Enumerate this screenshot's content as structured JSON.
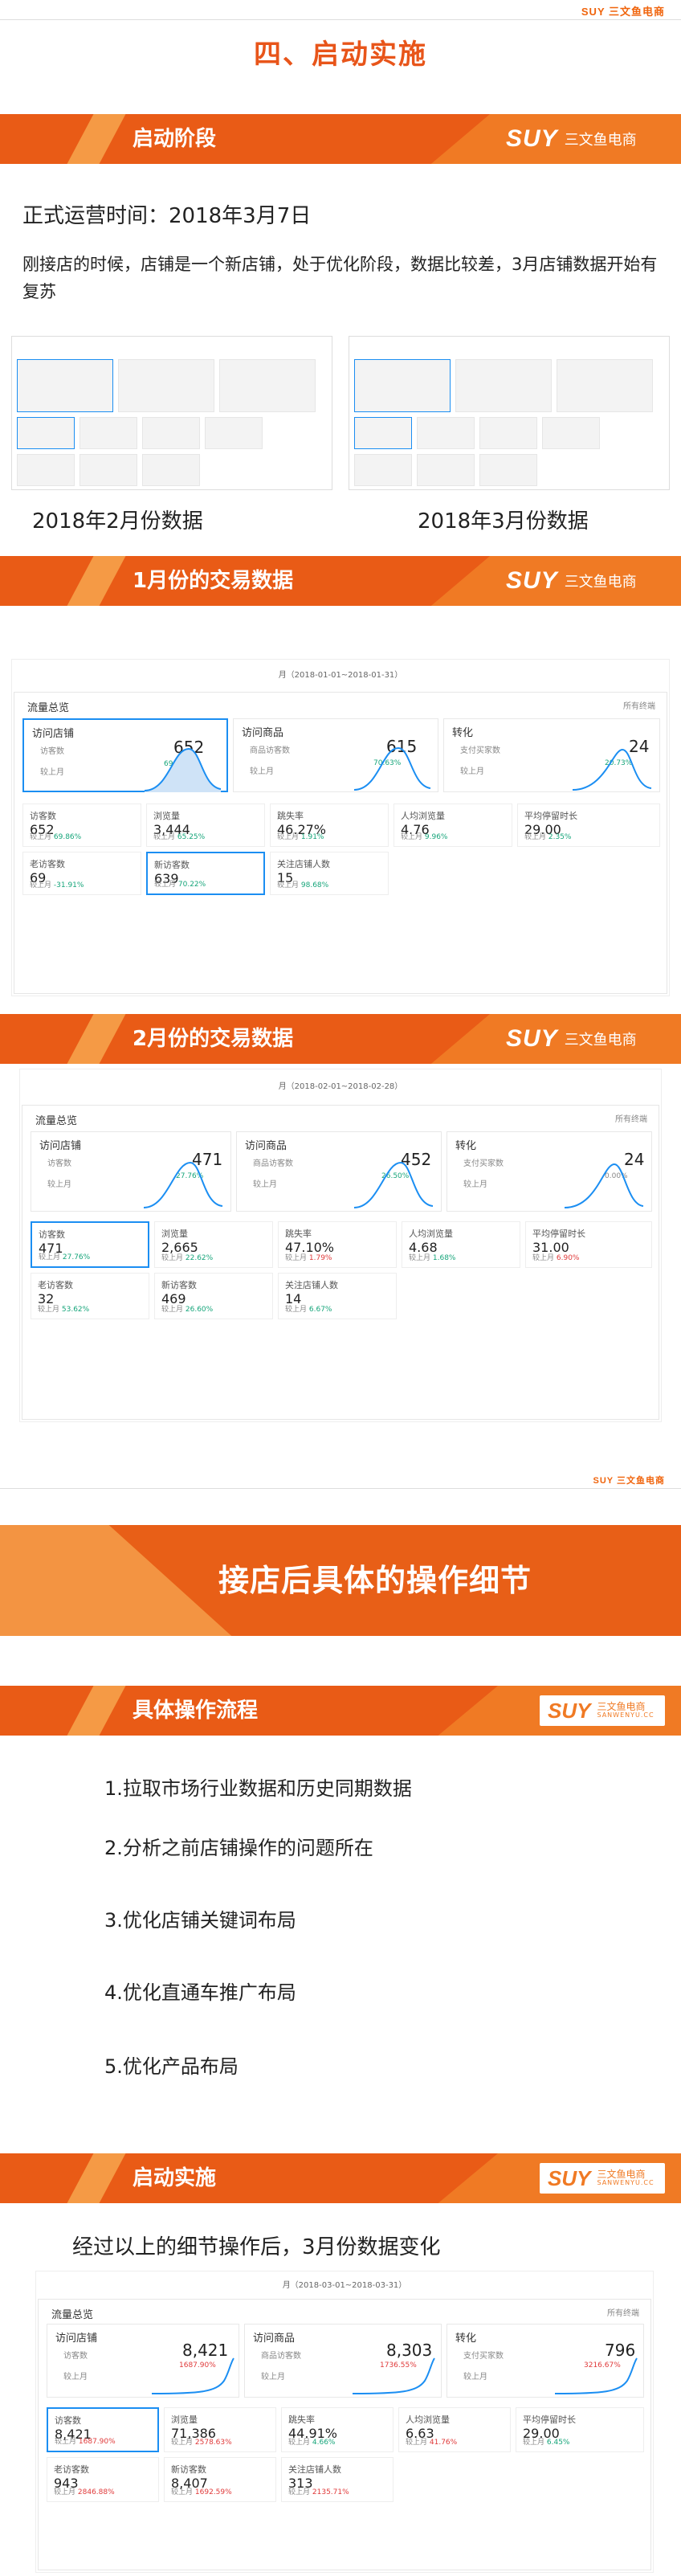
{
  "top_logo": "SUY 三文鱼电商",
  "section_title": "四、启动实施",
  "banners": {
    "launch_stage": "启动阶段",
    "jan_data": "1月份的交易数据",
    "feb_data": "2月份的交易数据",
    "procedure": "具体操作流程",
    "implementation": "启动实施",
    "brand_suy": "SUY",
    "brand_cn": "三文鱼电商",
    "brand_en": "SANWENYU.CC"
  },
  "intro": {
    "launch_time": "正式运营时间：2018年3月7日",
    "description": "刚接店的时候，店铺是一个新店铺，处于优化阶段，数据比较差，3月店铺数据开始有复苏",
    "caption_feb": "2018年2月份数据",
    "caption_mar": "2018年3月份数据"
  },
  "common": {
    "panel_title": "流量总览",
    "panel_right": "所有终端",
    "card1_title": "访问店铺",
    "card1_sub": "访客数",
    "card2_title": "访问商品",
    "card2_sub": "商品访客数",
    "card3_title": "转化",
    "card3_sub": "支付买家数",
    "compare": "较上月",
    "m_visitors": "访客数",
    "m_pv": "浏览量",
    "m_bounce": "跳失率",
    "m_pv_per": "人均浏览量",
    "m_stay": "平均停留时长",
    "m_old": "老访客数",
    "m_new": "新访客数",
    "m_fans": "关注店铺人数"
  },
  "jan": {
    "date_range": "月（2018-01-01~2018-01-31）",
    "card1_value": "652",
    "card1_change": "69.46%",
    "card2_value": "615",
    "card2_change": "70.63%",
    "card3_value": "24",
    "card3_change": "20.73%",
    "visitors": "652",
    "visitors_change": "69.86%",
    "pv": "3,444",
    "pv_change": "65.25%",
    "bounce": "46.27%",
    "bounce_change": "1.91%",
    "pv_per": "4.76",
    "pv_per_change": "9.96%",
    "stay": "29.00",
    "stay_change": "2.35%",
    "old": "69",
    "old_change": "-31.91%",
    "new": "639",
    "new_change": "70.22%",
    "fans": "15",
    "fans_change": "98.68%"
  },
  "feb": {
    "date_range": "月（2018-02-01~2018-02-28）",
    "card1_value": "471",
    "card1_change": "27.76%",
    "card2_value": "452",
    "card2_change": "26.50%",
    "card3_value": "24",
    "card3_change": "0.00%",
    "visitors": "471",
    "visitors_change": "27.76%",
    "pv": "2,665",
    "pv_change": "22.62%",
    "bounce": "47.10%",
    "bounce_change": "1.79%",
    "pv_per": "4.68",
    "pv_per_change": "1.68%",
    "stay": "31.00",
    "stay_change": "6.90%",
    "old": "32",
    "old_change": "53.62%",
    "new": "469",
    "new_change": "26.60%",
    "fans": "14",
    "fans_change": "6.67%"
  },
  "mar": {
    "date_range": "月（2018-03-01~2018-03-31）",
    "card1_value": "8,421",
    "card1_change": "1687.90%",
    "card2_value": "8,303",
    "card2_change": "1736.55%",
    "card3_value": "796",
    "card3_change": "3216.67%",
    "visitors": "8,421",
    "visitors_change": "1687.90%",
    "pv": "71,386",
    "pv_change": "2578.63%",
    "bounce": "44.91%",
    "bounce_change": "4.66%",
    "pv_per": "6.63",
    "pv_per_change": "41.76%",
    "stay": "29.00",
    "stay_change": "6.45%",
    "old": "943",
    "old_change": "2846.88%",
    "new": "8,407",
    "new_change": "1692.59%",
    "fans": "313",
    "fans_change": "2135.71%"
  },
  "details_banner": "接店后具体的操作细节",
  "steps": [
    "1.拉取市场行业数据和历史同期数据",
    "2.分析之前店铺操作的问题所在",
    "3.优化店铺关键词布局",
    "4.优化直通车推广布局",
    "5.优化产品布局"
  ],
  "result_text": "经过以上的细节操作后，3月份数据变化",
  "colors": {
    "orange": "#f07a24",
    "dark_orange": "#e95b16",
    "blue": "#1b8ef2",
    "red": "#e03a3a",
    "green": "#16a57a"
  }
}
